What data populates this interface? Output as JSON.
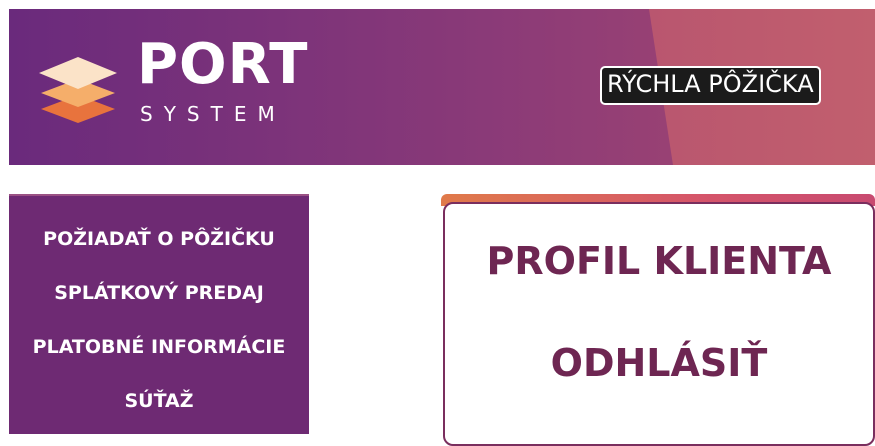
{
  "header": {
    "logo": {
      "brand": "PORT",
      "sub": "SYSTEM",
      "mark_colors": [
        "#fbe3c8",
        "#f5ae6a",
        "#e8733d"
      ]
    },
    "quick_loan_label": "RÝCHLA PÔŽIČKA"
  },
  "sidebar": {
    "items": [
      {
        "label": "POŽIADAŤ O PÔŽIČKU"
      },
      {
        "label": "SPLÁTKOVÝ PREDAJ"
      },
      {
        "label": "PLATOBNÉ INFORMÁCIE"
      },
      {
        "label": "SÚŤAŽ"
      }
    ]
  },
  "account": {
    "profile_label": "PROFIL KLIENTA",
    "logout_label": "ODHLÁSIŤ"
  },
  "colors": {
    "header_gradient_start": "#6a2a7c",
    "header_gradient_end": "#c4626d",
    "sidebar_bg": "#6e2a73",
    "account_text": "#6e2652",
    "account_border": "#7a2e5e"
  }
}
